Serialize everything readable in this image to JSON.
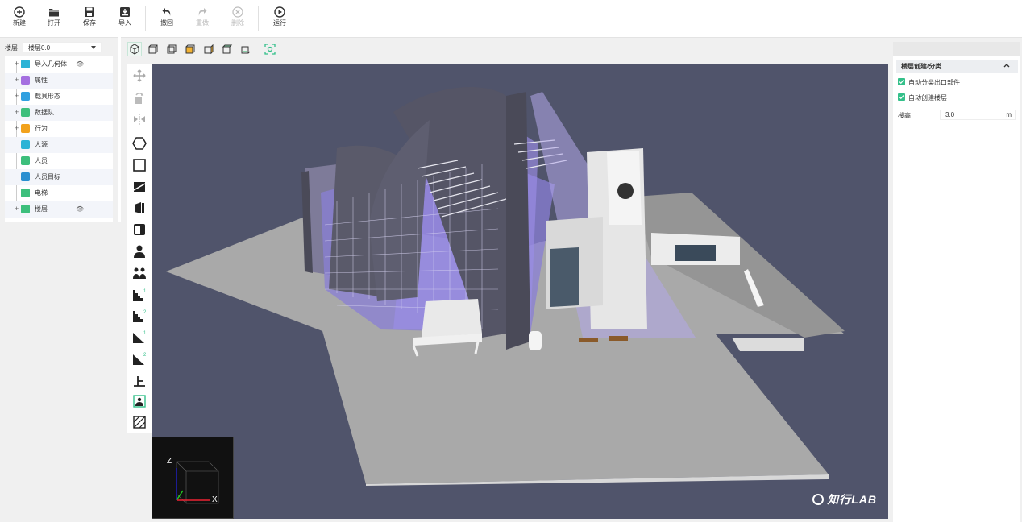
{
  "toolbar": {
    "buttons": [
      {
        "label": "新建",
        "icon": "new-icon"
      },
      {
        "label": "打开",
        "icon": "open-folder-icon"
      },
      {
        "label": "保存",
        "icon": "save-icon"
      },
      {
        "label": "导入",
        "icon": "import-icon"
      },
      {
        "label": "撤回",
        "icon": "undo-icon"
      },
      {
        "label": "重做",
        "icon": "redo-icon"
      },
      {
        "label": "删除",
        "icon": "delete-icon"
      },
      {
        "label": "运行",
        "icon": "run-icon"
      }
    ]
  },
  "left_panel": {
    "layer_label": "楼层",
    "layer_value": "楼层0.0",
    "tree": [
      {
        "label": "导入几何体",
        "color": "#2cb3d6",
        "expandable": true,
        "eye": true
      },
      {
        "label": "属性",
        "color": "#a46fe0",
        "expandable": true,
        "eye": false
      },
      {
        "label": "载具形态",
        "color": "#30a0e0",
        "expandable": true,
        "eye": false
      },
      {
        "label": "数据队",
        "color": "#3dbf7c",
        "expandable": true,
        "eye": false
      },
      {
        "label": "行为",
        "color": "#f2a21c",
        "expandable": true,
        "eye": false
      },
      {
        "label": "人源",
        "color": "#2cb3d6",
        "expandable": false,
        "eye": false
      },
      {
        "label": "人员",
        "color": "#3dbf7c",
        "expandable": false,
        "eye": false
      },
      {
        "label": "人员目标",
        "color": "#2a8fd0",
        "expandable": false,
        "eye": false
      },
      {
        "label": "电梯",
        "color": "#3dbf7c",
        "expandable": false,
        "eye": false
      },
      {
        "label": "楼层",
        "color": "#3dbf7c",
        "expandable": true,
        "eye": true
      }
    ],
    "eye_glyph": "👁",
    "plus_glyph": "+"
  },
  "viewport": {
    "watermark": "知行LAB",
    "axis_x": "X",
    "axis_z": "Z"
  },
  "right_panel": {
    "section_title": "楼层创建/分类",
    "checkboxes": [
      {
        "label": "自动分类出口部件",
        "checked": true
      },
      {
        "label": "自动创建楼层",
        "checked": true
      }
    ],
    "height_label": "楼高",
    "height_value": "3.0",
    "height_unit": "m"
  },
  "colors": {
    "accent": "#34c08a",
    "viewport_bg": "#50546b",
    "glass": "#8a7fd6"
  }
}
